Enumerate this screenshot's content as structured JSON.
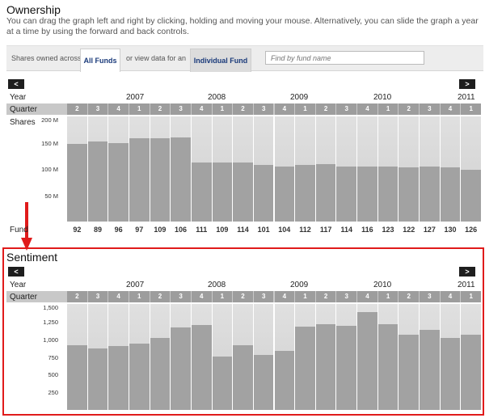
{
  "ownership": {
    "title": "Ownership",
    "description": "You can drag the graph left and right by clicking, holding and moving your mouse. Alternatively, you can slide the graph a year at a time by using the forward and back controls."
  },
  "filter": {
    "shares_label": "Shares owned across",
    "all_funds_tab": "All Funds",
    "view_label": "or view data for an",
    "individual_fund_tab": "Individual Fund",
    "search_placeholder": "Find by fund name"
  },
  "nav": {
    "prev": "<",
    "next": ">"
  },
  "labels": {
    "year": "Year",
    "quarter": "Quarter",
    "shares": "Shares",
    "fund": "Fund"
  },
  "years": [
    "2007",
    "2008",
    "2009",
    "2010",
    "2011"
  ],
  "quarters": [
    "2",
    "3",
    "4",
    "1",
    "2",
    "3",
    "4",
    "1",
    "2",
    "3",
    "4",
    "1",
    "2",
    "3",
    "4",
    "1",
    "2",
    "3",
    "4",
    "1"
  ],
  "shares_chart": {
    "y_ticks": [
      "200 M",
      "150 M",
      "100 M",
      "50 M"
    ],
    "tick_values": [
      200,
      150,
      100,
      50
    ],
    "ymax": 200,
    "values": [
      148,
      152,
      149,
      158,
      158,
      160,
      112,
      112,
      112,
      108,
      104,
      108,
      109,
      105,
      104,
      104,
      103,
      104,
      103,
      99
    ],
    "fund_counts": [
      "92",
      "89",
      "96",
      "97",
      "109",
      "106",
      "111",
      "109",
      "114",
      "101",
      "104",
      "112",
      "117",
      "114",
      "116",
      "123",
      "122",
      "127",
      "130",
      "126"
    ]
  },
  "sentiment": {
    "title": "Sentiment",
    "y_ticks": [
      "1,500",
      "1,250",
      "1,000",
      "750",
      "500",
      "250"
    ],
    "tick_values": [
      1500,
      1250,
      1000,
      750,
      500,
      250
    ],
    "ymax": 1500,
    "values": [
      920,
      870,
      900,
      940,
      1020,
      1170,
      1200,
      760,
      920,
      780,
      840,
      1180,
      1210,
      1190,
      1380,
      1210,
      1060,
      1130,
      1020,
      1060
    ]
  }
}
